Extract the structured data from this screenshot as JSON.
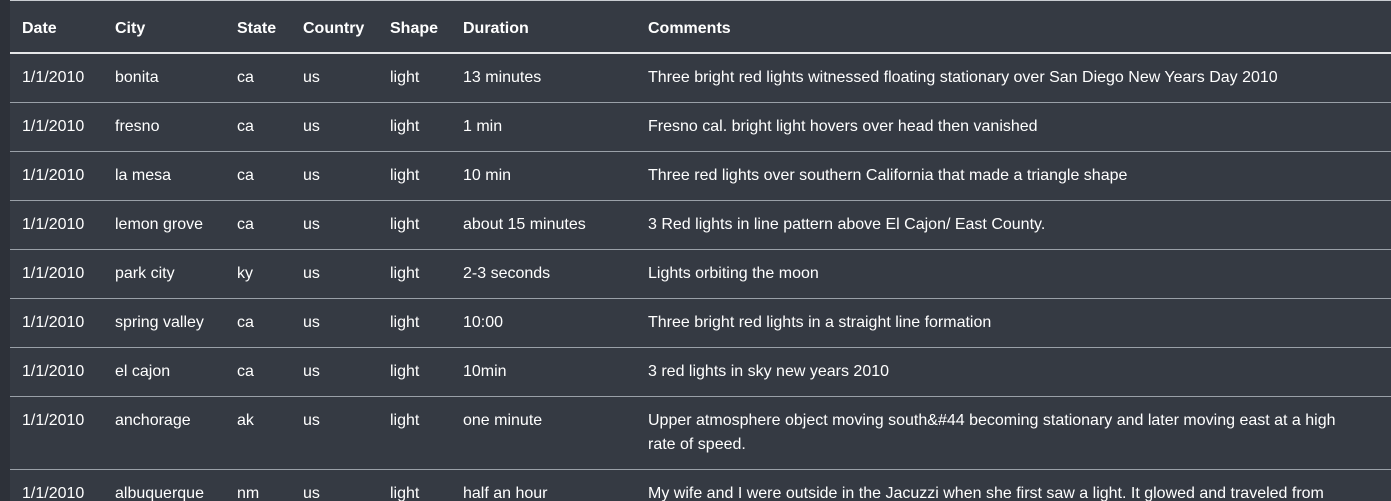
{
  "table": {
    "headers": [
      "Date",
      "City",
      "State",
      "Country",
      "Shape",
      "Duration",
      "Comments"
    ],
    "rows": [
      [
        "1/1/2010",
        "bonita",
        "ca",
        "us",
        "light",
        "13 minutes",
        "Three bright red lights witnessed floating stationary over San Diego New Years Day 2010"
      ],
      [
        "1/1/2010",
        "fresno",
        "ca",
        "us",
        "light",
        "1 min",
        "Fresno cal. bright light hovers over head then vanished"
      ],
      [
        "1/1/2010",
        "la mesa",
        "ca",
        "us",
        "light",
        "10 min",
        "Three red lights over southern California that made a triangle shape"
      ],
      [
        "1/1/2010",
        "lemon grove",
        "ca",
        "us",
        "light",
        "about 15 minutes",
        "3 Red lights in line pattern above El Cajon/ East County."
      ],
      [
        "1/1/2010",
        "park city",
        "ky",
        "us",
        "light",
        "2-3 seconds",
        "Lights orbiting the moon"
      ],
      [
        "1/1/2010",
        "spring valley",
        "ca",
        "us",
        "light",
        "10:00",
        "Three bright red lights in a straight line formation"
      ],
      [
        "1/1/2010",
        "el cajon",
        "ca",
        "us",
        "light",
        "10min",
        "3 red lights in sky new years 2010"
      ],
      [
        "1/1/2010",
        "anchorage",
        "ak",
        "us",
        "light",
        "one minute",
        "Upper atmosphere object moving south&#44 becoming stationary and later moving east at a high rate of speed."
      ],
      [
        "1/1/2010",
        "albuquerque",
        "nm",
        "us",
        "light",
        "half an hour",
        "My wife and I were outside in the Jacuzzi when she first saw a light. It glowed and traveled from"
      ]
    ]
  },
  "colors": {
    "background": "#353a43",
    "left_strip": "#2d3139",
    "text": "#ffffff",
    "row_divider": "#9aa0a8",
    "header_divider": "#e6e7e9"
  }
}
